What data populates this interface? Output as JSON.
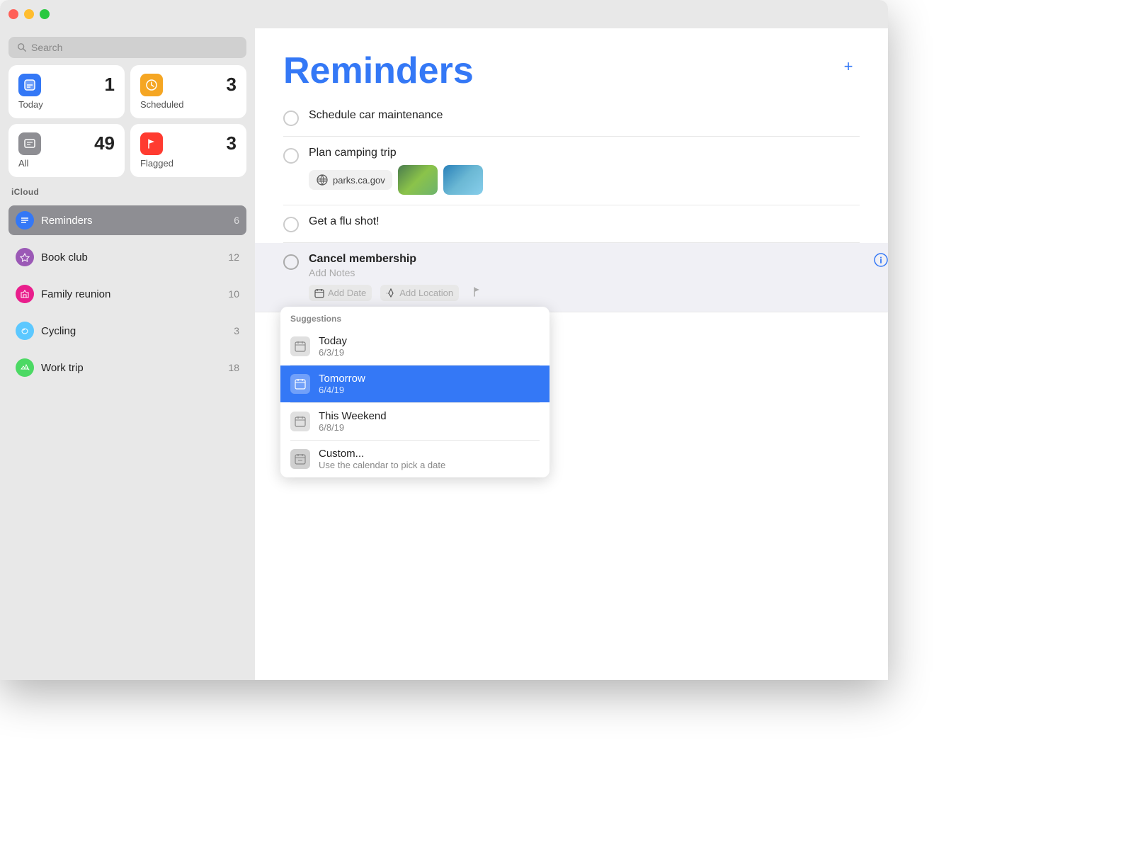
{
  "titlebar": {
    "traffic_lights": [
      "red",
      "yellow",
      "green"
    ]
  },
  "sidebar": {
    "search_placeholder": "Search",
    "smart_tiles": [
      {
        "id": "today",
        "label": "Today",
        "count": "1",
        "icon_color": "tile-blue",
        "icon": "📋"
      },
      {
        "id": "scheduled",
        "label": "Scheduled",
        "count": "3",
        "icon_color": "tile-orange",
        "icon": "🕐"
      },
      {
        "id": "all",
        "label": "All",
        "count": "49",
        "icon_color": "tile-gray",
        "icon": "📥"
      },
      {
        "id": "flagged",
        "label": "Flagged",
        "count": "3",
        "icon_color": "tile-red",
        "icon": "🚩"
      }
    ],
    "icloud_label": "iCloud",
    "lists": [
      {
        "id": "reminders",
        "label": "Reminders",
        "count": "6",
        "icon_bg": "#3478f6",
        "icon": "≡",
        "active": true
      },
      {
        "id": "bookclub",
        "label": "Book club",
        "count": "12",
        "icon_bg": "#9b59b6",
        "icon": "▲"
      },
      {
        "id": "familyreunion",
        "label": "Family reunion",
        "count": "10",
        "icon_bg": "#e91e8c",
        "icon": "⌂"
      },
      {
        "id": "cycling",
        "label": "Cycling",
        "count": "3",
        "icon_bg": "#5cc8ff",
        "icon": "♥"
      },
      {
        "id": "worktrip",
        "label": "Work trip",
        "count": "18",
        "icon_bg": "#4cd964",
        "icon": "✈"
      }
    ]
  },
  "main": {
    "title": "Reminders",
    "add_button_label": "+",
    "reminders": [
      {
        "id": "r1",
        "title": "Schedule car maintenance",
        "bold": false,
        "active": false
      },
      {
        "id": "r2",
        "title": "Plan camping trip",
        "bold": false,
        "active": false,
        "attachment_link": "parks.ca.gov"
      },
      {
        "id": "r3",
        "title": "Get a flu shot!",
        "bold": false,
        "active": false
      },
      {
        "id": "r4",
        "title": "Cancel membership",
        "bold": true,
        "active": true,
        "note_placeholder": "Add Notes",
        "add_date_label": "Add Date",
        "add_location_label": "Add Location"
      }
    ],
    "suggestions": {
      "title": "Suggestions",
      "items": [
        {
          "id": "today",
          "label": "Today",
          "date": "6/3/19",
          "selected": false
        },
        {
          "id": "tomorrow",
          "label": "Tomorrow",
          "date": "6/4/19",
          "selected": true
        },
        {
          "id": "weekend",
          "label": "This Weekend",
          "date": "6/8/19",
          "selected": false
        },
        {
          "id": "custom",
          "label": "Custom...",
          "date": "Use the calendar to pick a date",
          "selected": false
        }
      ]
    }
  }
}
